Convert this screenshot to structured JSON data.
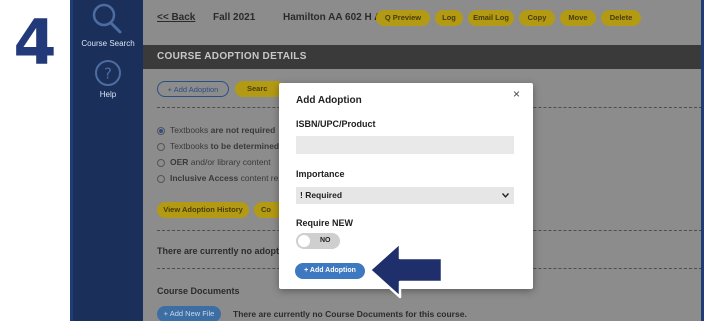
{
  "step": "4",
  "sidebar": {
    "items": [
      {
        "label": "Course Search",
        "icon": "search-icon"
      },
      {
        "label": "Help",
        "icon": "help-icon"
      }
    ]
  },
  "topbar": {
    "back": "<< Back",
    "term": "Fall 2021",
    "course": "Hamilton AA 602 H A",
    "buttons": [
      "Q Preview",
      "Log",
      "Email Log",
      "Copy",
      "Move",
      "Delete"
    ]
  },
  "section": {
    "title": "COURSE ADOPTION DETAILS",
    "add_adoption": "+ Add Adoption",
    "search_partial": "Searc",
    "radios": [
      {
        "prefix": "Textbooks ",
        "bold": "are not required",
        "rest": "",
        "selected": true
      },
      {
        "prefix": "Textbooks ",
        "bold": "to be determined",
        "rest": "",
        "selected": false
      },
      {
        "prefix": "",
        "bold": "OER",
        "rest": " and/or library content",
        "selected": false
      },
      {
        "prefix": "",
        "bold": "Inclusive Access",
        "rest": " content re",
        "selected": false
      }
    ],
    "view_history": "View Adoption History",
    "co_partial": "Co",
    "no_adoptions": "There are currently no adopt",
    "course_docs_title": "Course Documents",
    "add_new_file": "+ Add New File",
    "no_docs": "There are currently no Course Documents for this course."
  },
  "modal": {
    "title": "Add Adoption",
    "close": "×",
    "isbn_label": "ISBN/UPC/Product",
    "isbn_value": "",
    "importance_label": "Importance",
    "importance_value": "! Required",
    "require_new_label": "Require NEW",
    "toggle_text": "NO",
    "submit": "+ Add Adoption"
  },
  "colors": {
    "sidebar": "#1a2f5a",
    "pill_gold": "#b39a14",
    "arrow_navy": "#1f2f6b",
    "button_blue": "#3e78c0"
  }
}
